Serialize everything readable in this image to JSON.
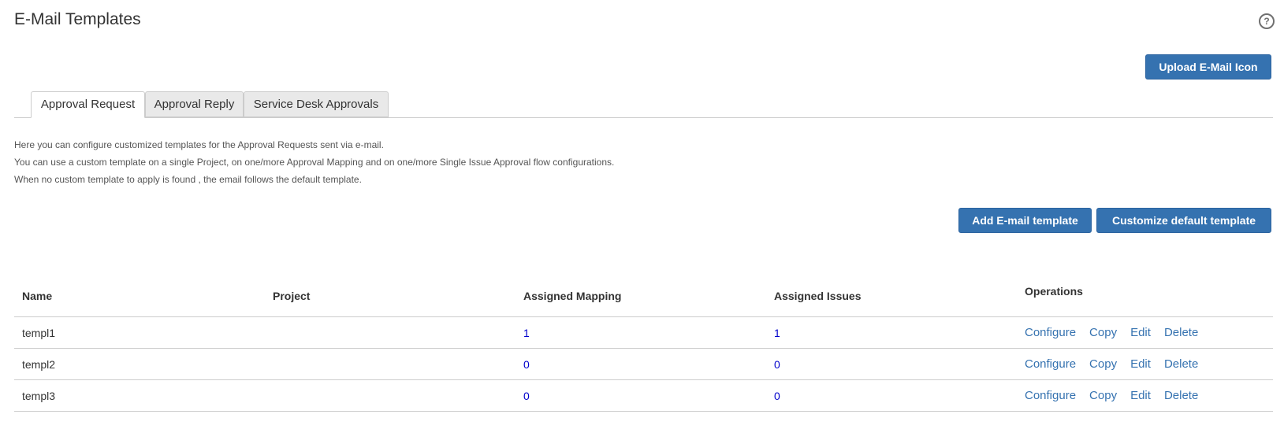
{
  "page": {
    "title": "E-Mail Templates",
    "help_icon": "?"
  },
  "buttons": {
    "upload": "Upload E-Mail Icon",
    "add_template": "Add E-mail template",
    "customize_default": "Customize default template"
  },
  "tabs": [
    {
      "label": "Approval Request",
      "active": true
    },
    {
      "label": "Approval Reply",
      "active": false
    },
    {
      "label": "Service Desk Approvals",
      "active": false
    }
  ],
  "description": [
    "Here you can configure customized templates for the Approval Requests sent via e-mail.",
    "You can use a custom template on a single Project, on one/more Approval Mapping and on one/more Single Issue Approval flow configurations.",
    "When no custom template to apply is found , the email follows the default template."
  ],
  "table": {
    "headers": [
      "Name",
      "Project",
      "Assigned Mapping",
      "Assigned Issues",
      "Operations"
    ],
    "rows": [
      {
        "name": "templ1",
        "project": "",
        "mapping": "1",
        "issues": "1"
      },
      {
        "name": "templ2",
        "project": "",
        "mapping": "0",
        "issues": "0"
      },
      {
        "name": "templ3",
        "project": "",
        "mapping": "0",
        "issues": "0"
      }
    ],
    "operations": [
      "Configure",
      "Copy",
      "Edit",
      "Delete"
    ]
  },
  "colors": {
    "primary_button": "#3572b0",
    "link": "#3572b0",
    "count_link": "#0000cc"
  }
}
